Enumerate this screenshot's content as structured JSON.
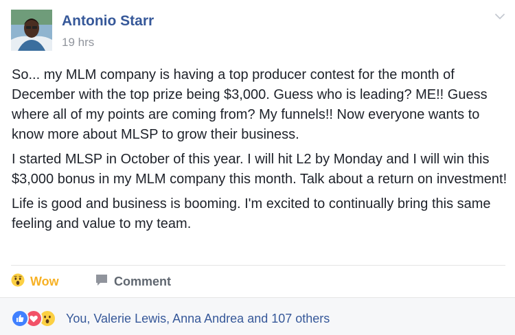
{
  "post": {
    "author": "Antonio Starr",
    "timestamp": "19 hrs",
    "paragraphs": [
      "So... my MLM company is having a top producer contest for the month of December with the top prize being $3,000. Guess who is leading? ME!! Guess where all of my points are coming from? My funnels!! Now everyone wants to know more about MLSP to grow their business.",
      "I started MLSP in October of this year. I will hit L2 by Monday and I will win this $3,000 bonus in my MLM company this month. Talk about a return on investment!",
      "Life is good and business is booming. I'm excited to continually bring this same feeling and value to my team."
    ]
  },
  "actions": {
    "wow_label": "Wow",
    "comment_label": "Comment"
  },
  "footer": {
    "reaction_icons": [
      "like-icon",
      "love-icon",
      "wow-icon"
    ],
    "reactors_text": "You, Valerie Lewis, Anna Andrea and 107 others"
  },
  "colors": {
    "author_link": "#365899",
    "wow_active": "#f7b125",
    "muted": "#90949c",
    "like_blue": "#4080ff",
    "love_red": "#f25268"
  },
  "icons": {
    "menu": "chevron-down-icon",
    "wow_action": "wow-emoji-icon",
    "comment_action": "speech-bubble-icon"
  }
}
